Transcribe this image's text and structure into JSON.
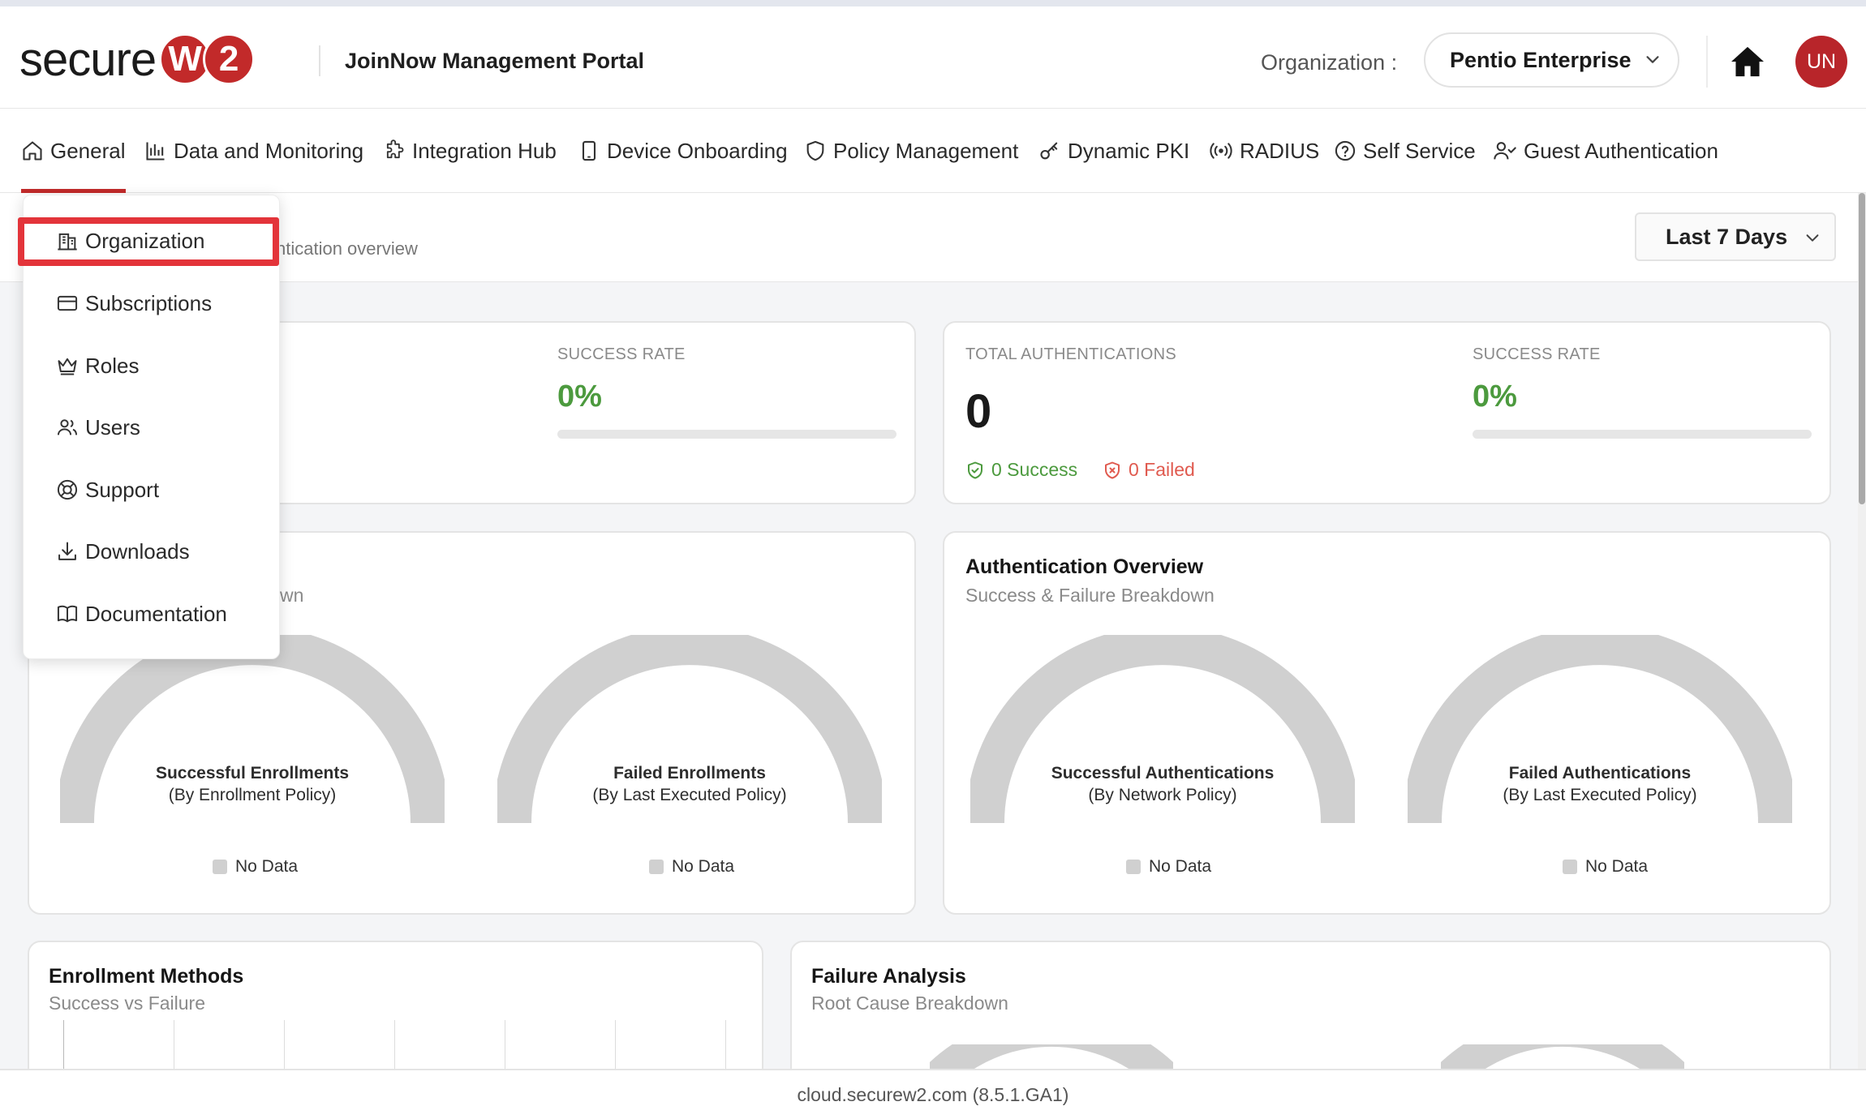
{
  "header": {
    "logo_text": "secure",
    "logo_badge": [
      "W",
      "2"
    ],
    "portal_title": "JoinNow Management Portal",
    "org_label": "Organization :",
    "org_selected": "Pentio Enterprise",
    "avatar_initials": "UN"
  },
  "nav": {
    "items": [
      {
        "label": "General",
        "icon": "home-icon"
      },
      {
        "label": "Data and Monitoring",
        "icon": "bar-chart-icon"
      },
      {
        "label": "Integration Hub",
        "icon": "puzzle-icon"
      },
      {
        "label": "Device Onboarding",
        "icon": "phone-icon"
      },
      {
        "label": "Policy Management",
        "icon": "shield-icon"
      },
      {
        "label": "Dynamic PKI",
        "icon": "key-icon"
      },
      {
        "label": "RADIUS",
        "icon": "radio-signal-icon"
      },
      {
        "label": "Self Service",
        "icon": "help-circle-icon"
      },
      {
        "label": "Guest Authentication",
        "icon": "user-check-icon"
      }
    ],
    "active": "General"
  },
  "dropdown": {
    "items": [
      {
        "label": "Organization",
        "icon": "building-icon"
      },
      {
        "label": "Subscriptions",
        "icon": "credit-card-icon"
      },
      {
        "label": "Roles",
        "icon": "crown-icon"
      },
      {
        "label": "Users",
        "icon": "users-icon"
      },
      {
        "label": "Support",
        "icon": "lifebuoy-icon"
      },
      {
        "label": "Downloads",
        "icon": "download-icon"
      },
      {
        "label": "Documentation",
        "icon": "book-icon"
      }
    ],
    "highlighted": "Organization"
  },
  "subheader": {
    "description_partial": "ntication overview",
    "range_selected": "Last 7 Days"
  },
  "enrollment_stats": {
    "success_rate_label": "SUCCESS RATE",
    "success_rate_value": "0%",
    "success_rate_fraction": 0
  },
  "auth_stats": {
    "total_label": "TOTAL AUTHENTICATIONS",
    "total_value": "0",
    "success_text": "0 Success",
    "failed_text": "0 Failed",
    "success_rate_label": "SUCCESS RATE",
    "success_rate_value": "0%",
    "success_rate_fraction": 0
  },
  "enrollment_overview": {
    "subtitle_partial": "wn",
    "gauges": [
      {
        "title": "Successful Enrollments",
        "subtitle": "(By Enrollment Policy)",
        "legend": "No Data"
      },
      {
        "title": "Failed Enrollments",
        "subtitle": "(By Last Executed Policy)",
        "legend": "No Data"
      }
    ]
  },
  "auth_overview": {
    "title": "Authentication Overview",
    "subtitle": "Success & Failure Breakdown",
    "gauges": [
      {
        "title": "Successful Authentications",
        "subtitle": "(By Network Policy)",
        "legend": "No Data"
      },
      {
        "title": "Failed Authentications",
        "subtitle": "(By Last Executed Policy)",
        "legend": "No Data"
      }
    ]
  },
  "enrollment_methods": {
    "title": "Enrollment Methods",
    "subtitle": "Success vs Failure"
  },
  "failure_analysis": {
    "title": "Failure Analysis",
    "subtitle": "Root Cause Breakdown"
  },
  "footer": {
    "text": "cloud.securew2.com (8.5.1.GA1)"
  },
  "colors": {
    "brand_red": "#c22a2a",
    "success_green": "#4c9a3e",
    "failed_red": "#e05a4f",
    "gauge_empty": "#d0d0d0"
  }
}
